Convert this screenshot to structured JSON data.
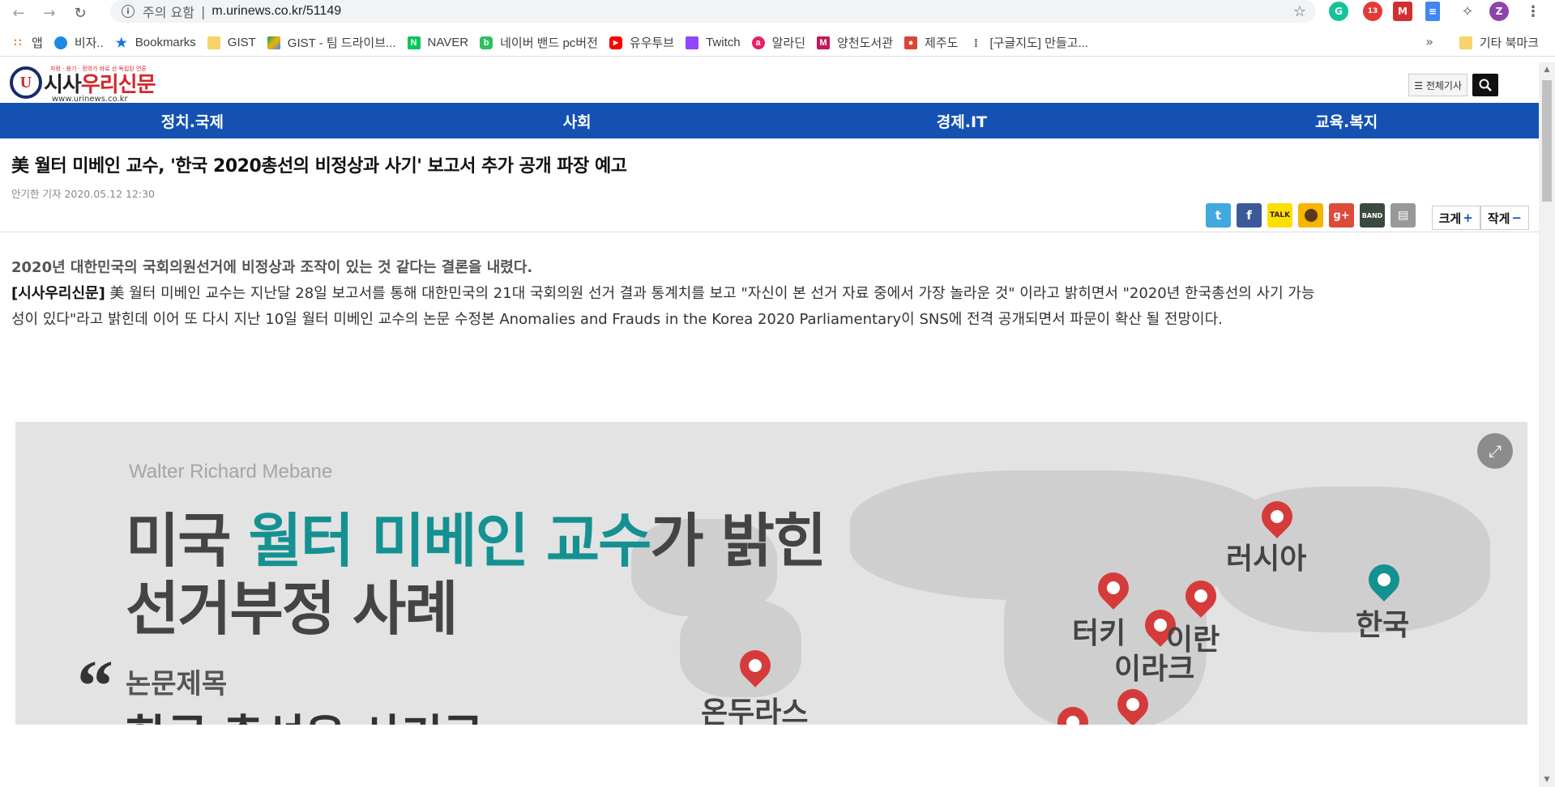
{
  "browser": {
    "security_label": "주의 요함",
    "url": "m.urinews.co.kr/51149",
    "extension_badge": "13",
    "profile_initial": "Z"
  },
  "bookmarks": {
    "items": [
      {
        "label": "앱",
        "icon": "apps-grid-icon"
      },
      {
        "label": "비자..",
        "icon": "cloud-icon"
      },
      {
        "label": "Bookmarks",
        "icon": "star-icon"
      },
      {
        "label": "GIST",
        "icon": "folder-icon"
      },
      {
        "label": "GIST - 팀 드라이브...",
        "icon": "drive-icon"
      },
      {
        "label": "NAVER",
        "icon": "naver-icon"
      },
      {
        "label": "네이버 밴드 pc버전",
        "icon": "band-icon"
      },
      {
        "label": "유우투브",
        "icon": "youtube-icon"
      },
      {
        "label": "Twitch",
        "icon": "twitch-icon"
      },
      {
        "label": "알라딘",
        "icon": "aladin-icon"
      },
      {
        "label": "양천도서관",
        "icon": "library-icon"
      },
      {
        "label": "제주도",
        "icon": "map-pin-icon"
      },
      {
        "label": "[구글지도] 만들고...",
        "icon": "tree-icon"
      }
    ],
    "more": "»",
    "other": "기타 북마크"
  },
  "site": {
    "logo_mark": "U",
    "logo_prefix": "시사",
    "logo_suffix": "우리신문",
    "logo_tagline": "자랑 · 용기 · 정의가 바로 선 독립된 언론",
    "logo_url": "www.urinews.co.kr",
    "all_articles": "☰ 전체기사"
  },
  "nav": [
    "정치.국제",
    "사회",
    "경제.IT",
    "교육.복지"
  ],
  "article": {
    "headline": "美 월터 미베인 교수, '한국 2020총선의 비정상과 사기' 보고서 추가 공개 파장 예고",
    "byline": "안기한 기자 2020.05.12 12:30",
    "size_up": "크게",
    "size_down": "작게",
    "lead": "2020년 대한민국의 국회의원선거에 비정상과 조작이 있는 것 같다는 결론을 내렸다.",
    "source": "[시사우리신문]",
    "body": " 美 월터 미베인 교수는 지난달 28일 보고서를 통해 대한민국의 21대 국회의원 선거 결과 통계치를 보고 \"자신이 본 선거 자료 중에서 가장 놀라운 것\" 이라고 밝히면서 \"2020년 한국총선의 사기 가능성이 있다\"라고 밝힌데 이어 또 다시 지난 10일 월터 미베인 교수의 논문 수정본 Anomalies and Frauds in the Korea 2020 Parliamentary이 SNS에 전격 공개되면서 파문이 확산 될 전망이다."
  },
  "figure": {
    "author": "Walter Richard Mebane",
    "title_part1": "미국 ",
    "title_teal": "월터 미베인 교수",
    "title_part2": "가 밝힌",
    "title_line2": "선거부정 사례",
    "quote_mark": "“",
    "paper_label": "논문제목",
    "paper_title": "한국 총선은 사기극",
    "pins": [
      "온두라스",
      "터키",
      "이라크",
      "이란",
      "러시아",
      "한국"
    ]
  },
  "colors": {
    "nav_blue": "#1451b3",
    "logo_red": "#d4262c",
    "teal": "#159191",
    "pin_red": "#d63b3b"
  }
}
